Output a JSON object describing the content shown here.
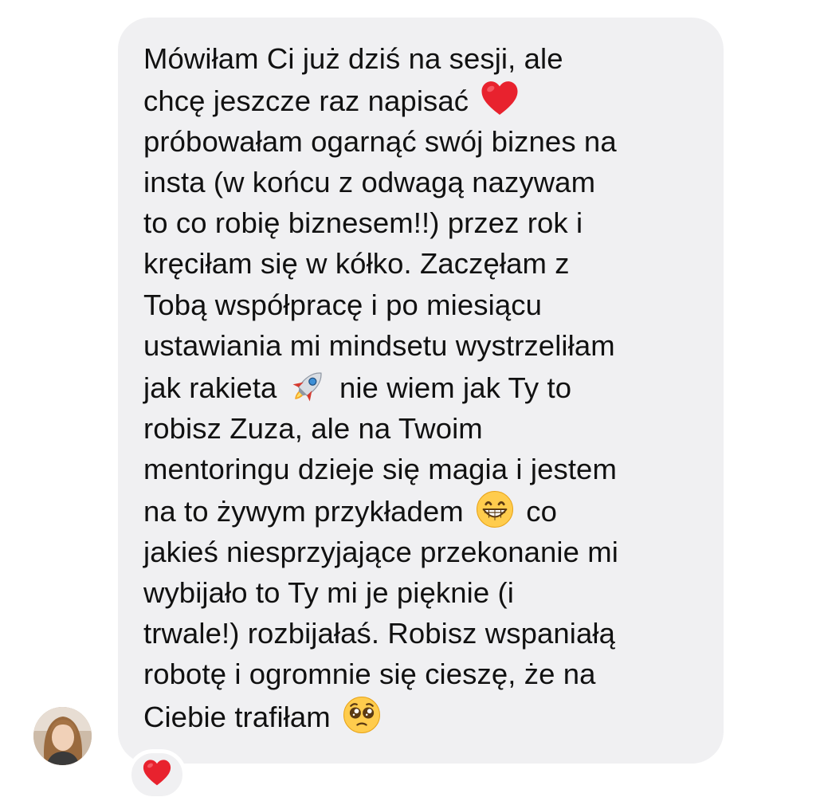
{
  "message": {
    "lines": [
      {
        "a": "Mówiłam Ci już dziś na sesji, ale"
      },
      {
        "a": "chcę jeszcze raz napisać ",
        "emoji": "red-heart-emoji"
      },
      {
        "a": "próbowałam ogarnąć swój biznes na"
      },
      {
        "a": "insta (w końcu z odwagą nazywam"
      },
      {
        "a": "to co robię biznesem!!) przez rok i"
      },
      {
        "a": "kręciłam się w kółko. Zaczęłam z"
      },
      {
        "a": "Tobą współpracę i po miesiącu"
      },
      {
        "a": "ustawiania mi mindsetu wystrzeliłam"
      },
      {
        "a": "jak rakieta ",
        "emoji": "rocket-emoji",
        "b": " nie wiem jak Ty to"
      },
      {
        "a": "robisz Zuza, ale na Twoim"
      },
      {
        "a": "mentoringu dzieje się magia i jestem"
      },
      {
        "a": "na to żywym przykładem ",
        "emoji": "grinning-face-emoji",
        "b": " co"
      },
      {
        "a": "jakieś niesprzyjające przekonanie mi"
      },
      {
        "a": "wybijało to Ty mi je pięknie (i"
      },
      {
        "a": "trwale!) rozbijałaś. Robisz wspaniałą"
      },
      {
        "a": "robotę i ogromnie się cieszę, że na"
      },
      {
        "a": "Ciebie trafiłam ",
        "emoji": "pleading-face-emoji"
      }
    ]
  },
  "reaction": {
    "emoji": "red-heart-emoji"
  },
  "colors": {
    "bubble": "#f0f0f2",
    "text": "#111111",
    "heart": "#e8222e"
  }
}
